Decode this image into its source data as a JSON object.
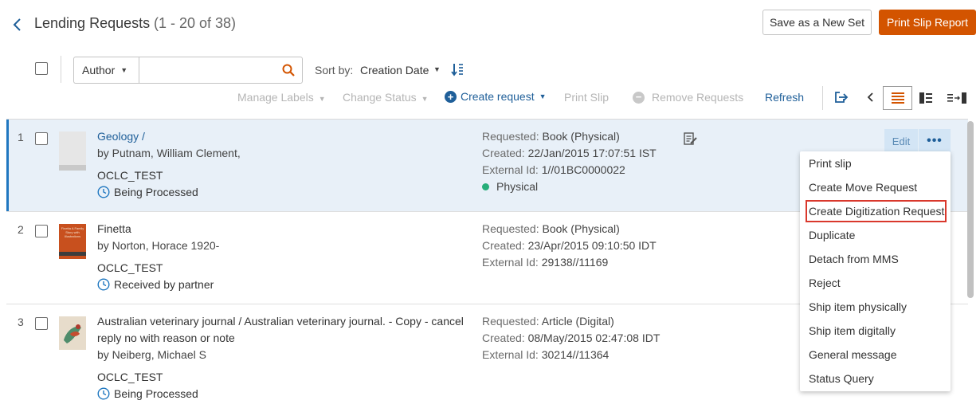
{
  "header": {
    "title": "Lending Requests",
    "count": "(1 - 20 of 38)",
    "save_set_label": "Save as a New Set",
    "print_report_label": "Print Slip Report"
  },
  "search": {
    "field": "Author",
    "query": "",
    "sort_label": "Sort by:",
    "sort_value": "Creation Date"
  },
  "toolbar": {
    "manage_labels": "Manage Labels",
    "change_status": "Change Status",
    "create_request": "Create request",
    "print_slip": "Print Slip",
    "remove_requests": "Remove Requests",
    "refresh": "Refresh"
  },
  "rows": [
    {
      "num": "1",
      "title": "Geology /",
      "author": "by Putnam, William Clement,",
      "owner": "OCLC_TEST",
      "status": "Being Processed",
      "requested_label": "Requested:",
      "requested": "Book (Physical)",
      "created_label": "Created:",
      "created": "22/Jan/2015 17:07:51 IST",
      "external_label": "External Id:",
      "external": "1//01BC0000022",
      "format": "Physical",
      "edit_label": "Edit",
      "more_label": "•••"
    },
    {
      "num": "2",
      "title": "Finetta",
      "author": "by Norton, Horace 1920-",
      "owner": "OCLC_TEST",
      "status": "Received by partner",
      "requested_label": "Requested:",
      "requested": "Book (Physical)",
      "created_label": "Created:",
      "created": "23/Apr/2015 09:10:50 IDT",
      "external_label": "External Id:",
      "external": "29138//11169",
      "cover_text": "Finetta A Family Story with Illustrations"
    },
    {
      "num": "3",
      "title_line1": "Australian veterinary journal / Australian veterinary journal. - Copy - cancel",
      "title_line2": "reply no with reason or note",
      "author": "by Neiberg, Michael S",
      "owner": "OCLC_TEST",
      "status": "Being Processed",
      "requested_label": "Requested:",
      "requested": "Article (Digital)",
      "created_label": "Created:",
      "created": "08/May/2015 02:47:08 IDT",
      "external_label": "External Id:",
      "external": "30214//11364"
    }
  ],
  "menu": {
    "items": [
      "Print slip",
      "Create Move Request",
      "Create Digitization Request",
      "Duplicate",
      "Detach from MMS",
      "Reject",
      "Ship item physically",
      "Ship item digitally",
      "General message",
      "Status Query"
    ],
    "highlighted_index": 2
  },
  "colors": {
    "accent": "#d35400",
    "link": "#1f5f99",
    "selected_row": "#e8f0f8",
    "status_green": "#27ae7a",
    "highlight_outline": "#d9382c"
  }
}
